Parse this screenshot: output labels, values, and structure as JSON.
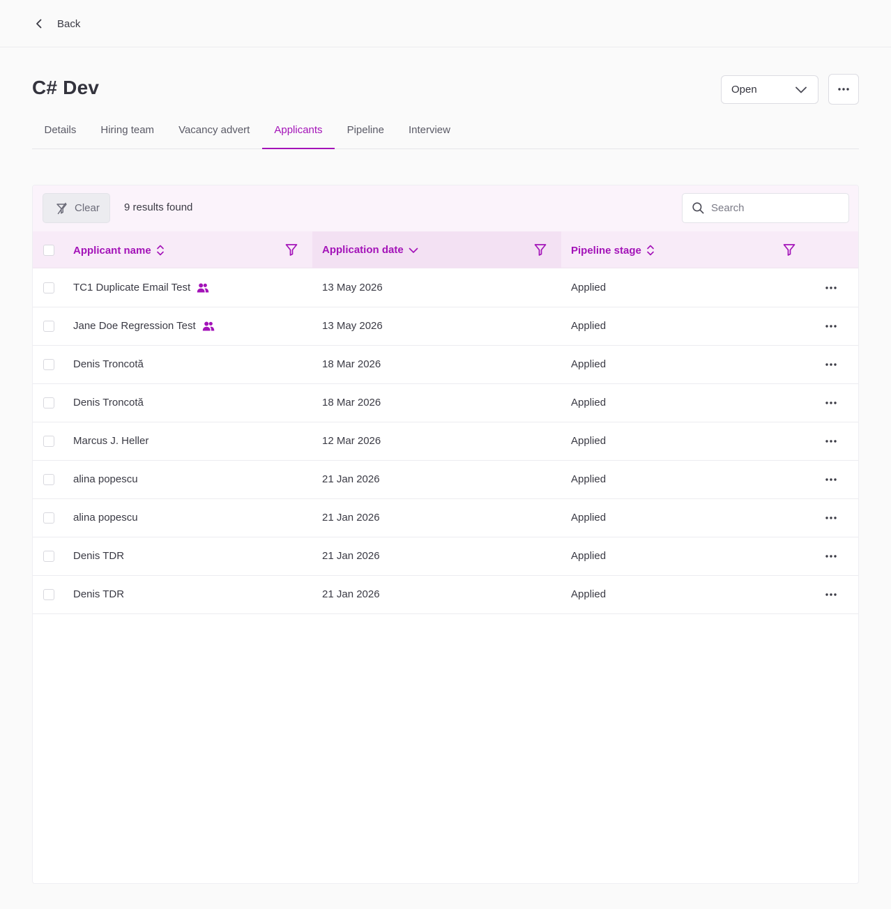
{
  "nav": {
    "back_label": "Back"
  },
  "header": {
    "title": "C# Dev",
    "status_value": "Open"
  },
  "tabs": [
    {
      "label": "Details"
    },
    {
      "label": "Hiring team"
    },
    {
      "label": "Vacancy advert"
    },
    {
      "label": "Applicants",
      "active": true
    },
    {
      "label": "Pipeline"
    },
    {
      "label": "Interview"
    }
  ],
  "toolbar": {
    "clear_label": "Clear",
    "results_text": "9 results found",
    "search_placeholder": "Search"
  },
  "table": {
    "columns": {
      "name": "Applicant name",
      "date": "Application date",
      "stage": "Pipeline stage"
    },
    "rows": [
      {
        "name": "TC1 Duplicate Email Test",
        "team": true,
        "date": "13 May 2026",
        "stage": "Applied"
      },
      {
        "name": "Jane Doe Regression Test",
        "team": true,
        "date": "13 May 2026",
        "stage": "Applied"
      },
      {
        "name": "Denis Troncotă",
        "team": false,
        "date": "18 Mar 2026",
        "stage": "Applied"
      },
      {
        "name": "Denis Troncotă",
        "team": false,
        "date": "18 Mar 2026",
        "stage": "Applied"
      },
      {
        "name": "Marcus J. Heller",
        "team": false,
        "date": "12 Mar 2026",
        "stage": "Applied"
      },
      {
        "name": "alina popescu",
        "team": false,
        "date": "21 Jan 2026",
        "stage": "Applied"
      },
      {
        "name": "alina popescu",
        "team": false,
        "date": "21 Jan 2026",
        "stage": "Applied"
      },
      {
        "name": "Denis TDR",
        "team": false,
        "date": "21 Jan 2026",
        "stage": "Applied"
      },
      {
        "name": "Denis TDR",
        "team": false,
        "date": "21 Jan 2026",
        "stage": "Applied"
      }
    ]
  },
  "colors": {
    "accent": "#a313b8",
    "header_bg": "#f8ebf8",
    "sorted_col_bg": "#f3e1f3"
  }
}
